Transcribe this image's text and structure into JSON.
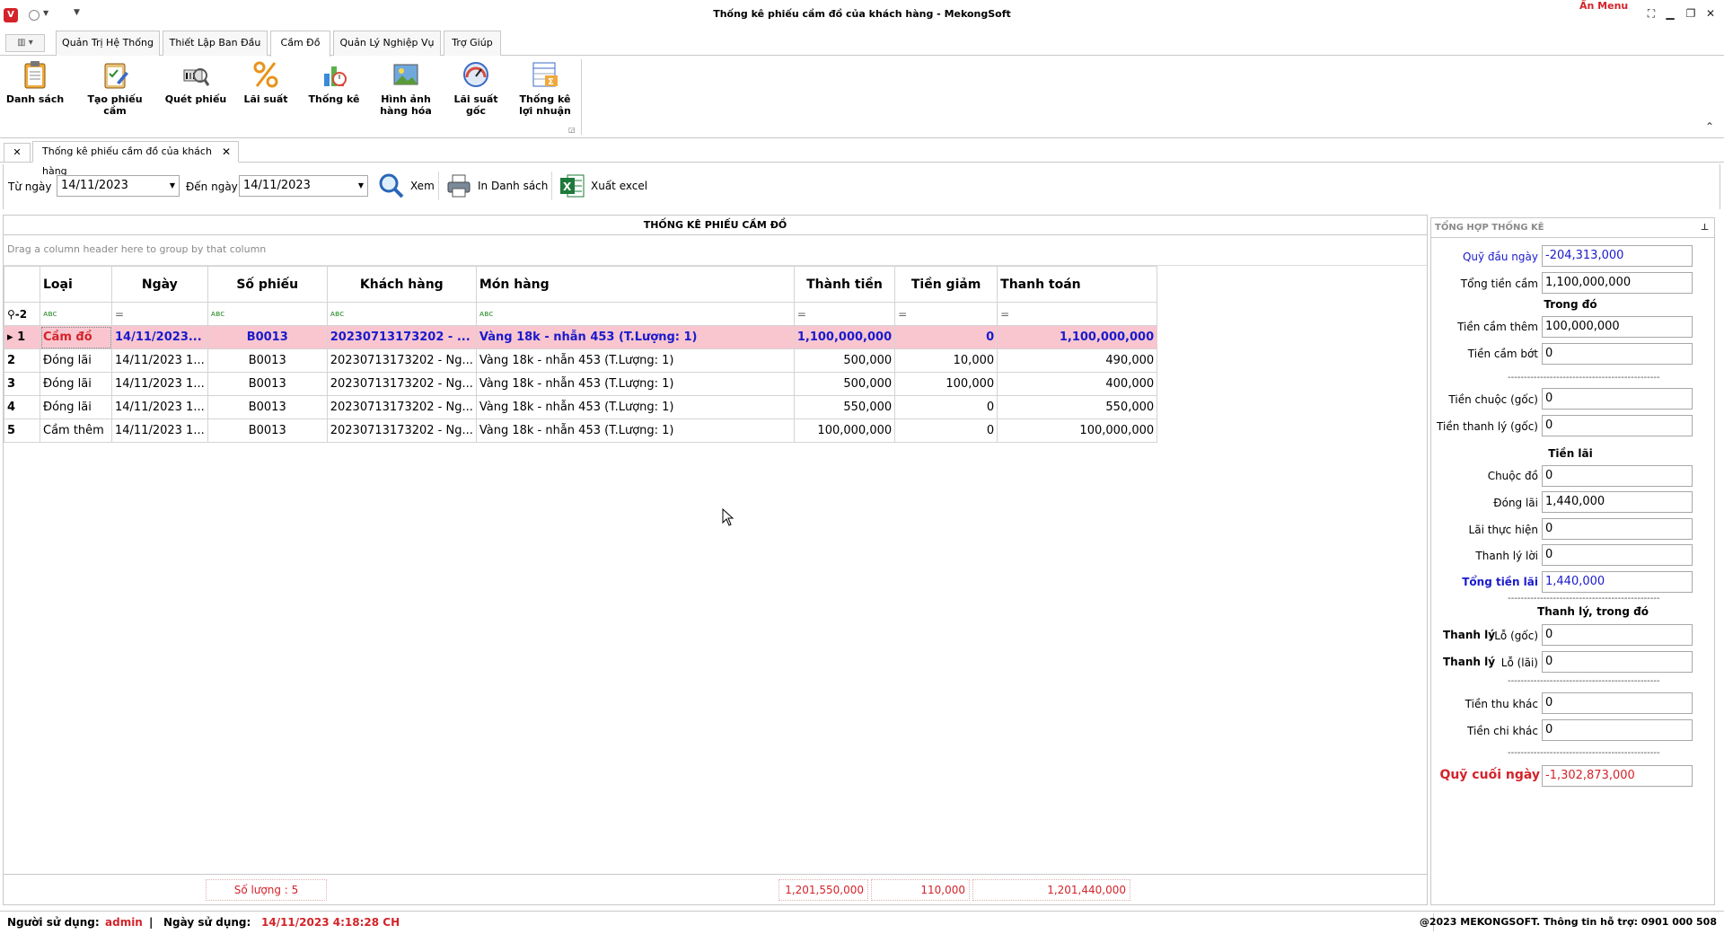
{
  "window": {
    "title": "Thống kê phiếu cầm đồ của khách hàng - MekongSoft",
    "an_menu": "Ẩn Menu"
  },
  "ribbon": {
    "tabs": [
      "Quản Trị Hệ Thống",
      "Thiết Lập Ban Đầu",
      "Cầm Đồ",
      "Quản Lý Nghiệp Vụ",
      "Trợ Giúp"
    ],
    "active_tab": "Cầm Đồ",
    "buttons": [
      {
        "line1": "Danh sách",
        "line2": "",
        "icon": "clipboard-icon"
      },
      {
        "line1": "Tạo phiếu cầm",
        "line2": "",
        "icon": "checklist-icon"
      },
      {
        "line1": "Quét phiếu",
        "line2": "",
        "icon": "scan-icon"
      },
      {
        "line1": "Lãi suất",
        "line2": "",
        "icon": "percent-icon"
      },
      {
        "line1": "Thống kê",
        "line2": "",
        "icon": "bar-chart-icon"
      },
      {
        "line1": "Hình ảnh",
        "line2": "hàng hóa",
        "icon": "image-icon"
      },
      {
        "line1": "Lãi suất",
        "line2": "gốc",
        "icon": "gauge-icon"
      },
      {
        "line1": "Thống kê",
        "line2": "lợi nhuận",
        "icon": "report-sum-icon"
      }
    ]
  },
  "document_tab": {
    "label": "Thống kê phiếu cầm đồ của khách hàng"
  },
  "toolbar": {
    "from_label": "Từ ngày",
    "from_value": "14/11/2023",
    "to_label": "Đến ngày",
    "to_value": "14/11/2023",
    "view_label": "Xem",
    "print_label": "In Danh sách",
    "excel_label": "Xuất excel"
  },
  "grid": {
    "title": "THỐNG KÊ PHIẾU CẦM ĐỒ",
    "group_hint": "Drag a column header here to group by that column",
    "columns": [
      "Loại",
      "Ngày",
      "Số phiếu",
      "Khách hàng",
      "Món hàng",
      "Thành tiền",
      "Tiền giảm",
      "Thanh toán"
    ],
    "filter_indicator": "-2",
    "rows": [
      {
        "index": "1",
        "loai": "Cầm đồ",
        "ngay": "14/11/2023...",
        "so_phieu": "B0013",
        "khach_hang": "20230713173202 - ...",
        "mon_hang": "Vàng 18k - nhẫn 453 (T.Lượng: 1)",
        "thanh_tien": "1,100,000,000",
        "tien_giam": "0",
        "thanh_toan": "1,100,000,000"
      },
      {
        "index": "2",
        "loai": "Đóng lãi",
        "ngay": "14/11/2023 1...",
        "so_phieu": "B0013",
        "khach_hang": "20230713173202 - Ng...",
        "mon_hang": "Vàng 18k - nhẫn 453 (T.Lượng: 1)",
        "thanh_tien": "500,000",
        "tien_giam": "10,000",
        "thanh_toan": "490,000"
      },
      {
        "index": "3",
        "loai": "Đóng lãi",
        "ngay": "14/11/2023 1...",
        "so_phieu": "B0013",
        "khach_hang": "20230713173202 - Ng...",
        "mon_hang": "Vàng 18k - nhẫn 453 (T.Lượng: 1)",
        "thanh_tien": "500,000",
        "tien_giam": "100,000",
        "thanh_toan": "400,000"
      },
      {
        "index": "4",
        "loai": "Đóng lãi",
        "ngay": "14/11/2023 1...",
        "so_phieu": "B0013",
        "khach_hang": "20230713173202 - Ng...",
        "mon_hang": "Vàng 18k - nhẫn 453 (T.Lượng: 1)",
        "thanh_tien": "550,000",
        "tien_giam": "0",
        "thanh_toan": "550,000"
      },
      {
        "index": "5",
        "loai": "Cầm thêm",
        "ngay": "14/11/2023 1...",
        "so_phieu": "B0013",
        "khach_hang": "20230713173202 - Ng...",
        "mon_hang": "Vàng 18k - nhẫn 453 (T.Lượng: 1)",
        "thanh_tien": "100,000,000",
        "tien_giam": "0",
        "thanh_toan": "100,000,000"
      }
    ],
    "footer": {
      "so_luong": "Số lượng : 5",
      "thanh_tien": "1,201,550,000",
      "tien_giam": "110,000",
      "thanh_toan": "1,201,440,000"
    }
  },
  "summary": {
    "header": "TỔNG HỢP THỐNG KÊ",
    "quy_dau_ngay_label": "Quỹ đầu ngày",
    "quy_dau_ngay": "-204,313,000",
    "tong_tien_cam_label": "Tổng tiền cầm",
    "tong_tien_cam": "1,100,000,000",
    "trong_do": "Trong đó",
    "tien_cam_them_label": "Tiền cầm thêm",
    "tien_cam_them": "100,000,000",
    "tien_cam_bot_label": "Tiền cầm bớt",
    "tien_cam_bot": "0",
    "dash": "------------------------------------------------",
    "tien_chuoc_goc_label": "Tiền chuộc (gốc)",
    "tien_chuoc_goc": "0",
    "tien_thanh_ly_goc_label": "Tiền thanh lý (gốc)",
    "tien_thanh_ly_goc": "0",
    "tien_lai_header": "Tiền lãi",
    "chuoc_do_label": "Chuộc đồ",
    "chuoc_do": "0",
    "dong_lai_label": "Đóng lãi",
    "dong_lai": "1,440,000",
    "lai_thuc_hien_label": "Lãi thực hiện",
    "lai_thuc_hien": "0",
    "thanh_ly_loi_label": "Thanh lý lời",
    "thanh_ly_loi": "0",
    "tong_tien_lai_label": "Tổng tiền lãi",
    "tong_tien_lai": "1,440,000",
    "thanh_ly_header": "Thanh lý,  trong đó",
    "thanh_ly_word": "Thanh lý",
    "lo_goc_label": "Lỗ (gốc)",
    "lo_goc": "0",
    "lo_lai_label": "Lỗ (lãi)",
    "lo_lai": "0",
    "tien_thu_khac_label": "Tiền thu khác",
    "tien_thu_khac": "0",
    "tien_chi_khac_label": "Tiền chi khác",
    "tien_chi_khac": "0",
    "quy_cuoi_ngay_label": "Quỹ cuối ngày",
    "quy_cuoi_ngay": "-1,302,873,000"
  },
  "status": {
    "user_label": "Người sử dụng:",
    "user": "admin",
    "pipe": "|",
    "date_label": "Ngày sử dụng:",
    "date": "14/11/2023 4:18:28 CH",
    "copyright": "@2023 MEKONGSOFT. Thông tin hỗ trợ: 0901 000 508"
  }
}
